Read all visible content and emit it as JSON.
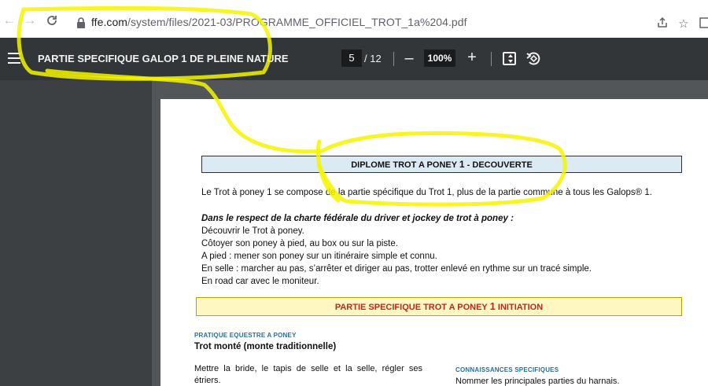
{
  "browser": {
    "url_host": "ffe.com",
    "url_path": "/system/files/2021-03/PROGRAMME_OFFICIEL_TROT_1a%204.pdf",
    "icons": [
      "back-arrow-icon",
      "forward-arrow-icon",
      "reload-icon",
      "lock-icon",
      "share-icon",
      "star-icon",
      "tab-icon"
    ]
  },
  "pdf_toolbar": {
    "title": "PARTIE SPECIFIQUE GALOP 1 DE PLEINE NATURE",
    "current_page": "5",
    "total_pages": "/ 12",
    "zoom": "100%",
    "zoom_out": "–",
    "zoom_in": "+"
  },
  "document": {
    "title_prefix": "Diplome trot a poney ",
    "title_number": "1",
    "title_suffix": " - Decouverte",
    "intro": "Le Trot à poney 1 se compose de la partie spécifique du Trot 1, plus de la partie commune à tous les Galops® 1.",
    "charter_heading": "Dans le respect de la charte fédérale du driver et jockey de trot à poney :",
    "lines": [
      "Découvrir le Trot à poney.",
      "Côtoyer son poney à pied, au box ou sur la piste.",
      "A pied : mener son poney sur un itinéraire simple et connu.",
      "En selle : marcher au pas, s’arrêter et diriger au pas, trotter enlevé en rythme sur un tracé simple.",
      "En road car avec le moniteur."
    ],
    "section_prefix": "Partie specifique trot a poney ",
    "section_number": "1",
    "section_suffix": " initiation",
    "practice_heading": "Pratique equestre a poney",
    "practice_sub": "Trot monté (monte traditionnelle)",
    "practice_text": "Mettre la bride, le tapis de selle et la selle, régler ses étriers.",
    "knowledge_heading": "Connaissances specifiques",
    "knowledge_text": "Nommer les principales parties du harnais."
  },
  "colors": {
    "toolbar": "#323639",
    "viewer_bg": "#525659",
    "title_box": "#dbeaf3",
    "section_box": "#fff7c2",
    "section_text": "#c0261f",
    "highlighter": "#f5f500"
  }
}
